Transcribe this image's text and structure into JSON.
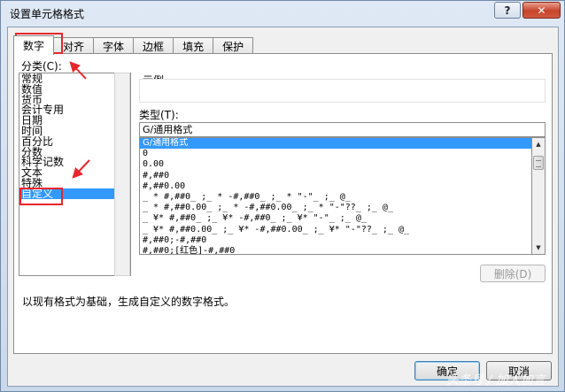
{
  "window": {
    "title": "设置单元格格式",
    "help_label": "?",
    "close_label": "✕"
  },
  "tabs": [
    {
      "label": "数字",
      "active": true
    },
    {
      "label": "对齐"
    },
    {
      "label": "字体"
    },
    {
      "label": "边框"
    },
    {
      "label": "填充"
    },
    {
      "label": "保护"
    }
  ],
  "category": {
    "label": "分类(C):",
    "items": [
      "常规",
      "数值",
      "货币",
      "会计专用",
      "日期",
      "时间",
      "百分比",
      "分数",
      "科学记数",
      "文本",
      "特殊",
      "自定义"
    ],
    "selected": "自定义"
  },
  "sample": {
    "label": "示例",
    "value": ""
  },
  "type": {
    "label": "类型(T):",
    "input_value": "G/通用格式",
    "items": [
      "G/通用格式",
      "0",
      "0.00",
      "#,##0",
      "#,##0.00",
      "_ * #,##0_ ;_ * -#,##0_ ;_ * \"-\"_ ;_ @_ ",
      "_ * #,##0.00_ ;_ * -#,##0.00_ ;_ * \"-\"??_ ;_ @_ ",
      "_ ¥* #,##0_ ;_ ¥* -#,##0_ ;_ ¥* \"-\"_ ;_ @_ ",
      "_ ¥* #,##0.00_ ;_ ¥* -#,##0.00_ ;_ ¥* \"-\"??_ ;_ @_ ",
      "#,##0;-#,##0",
      "#,##0;[红色]-#,##0"
    ]
  },
  "delete_button": "删除(D)",
  "description": "以现有格式为基础，生成自定义的数字格式。",
  "footer": {
    "ok": "确定",
    "cancel": "取消"
  },
  "watermark": "头条号 / 加人加言",
  "colors": {
    "highlight": "#e8262d",
    "selection": "#3399ff"
  }
}
